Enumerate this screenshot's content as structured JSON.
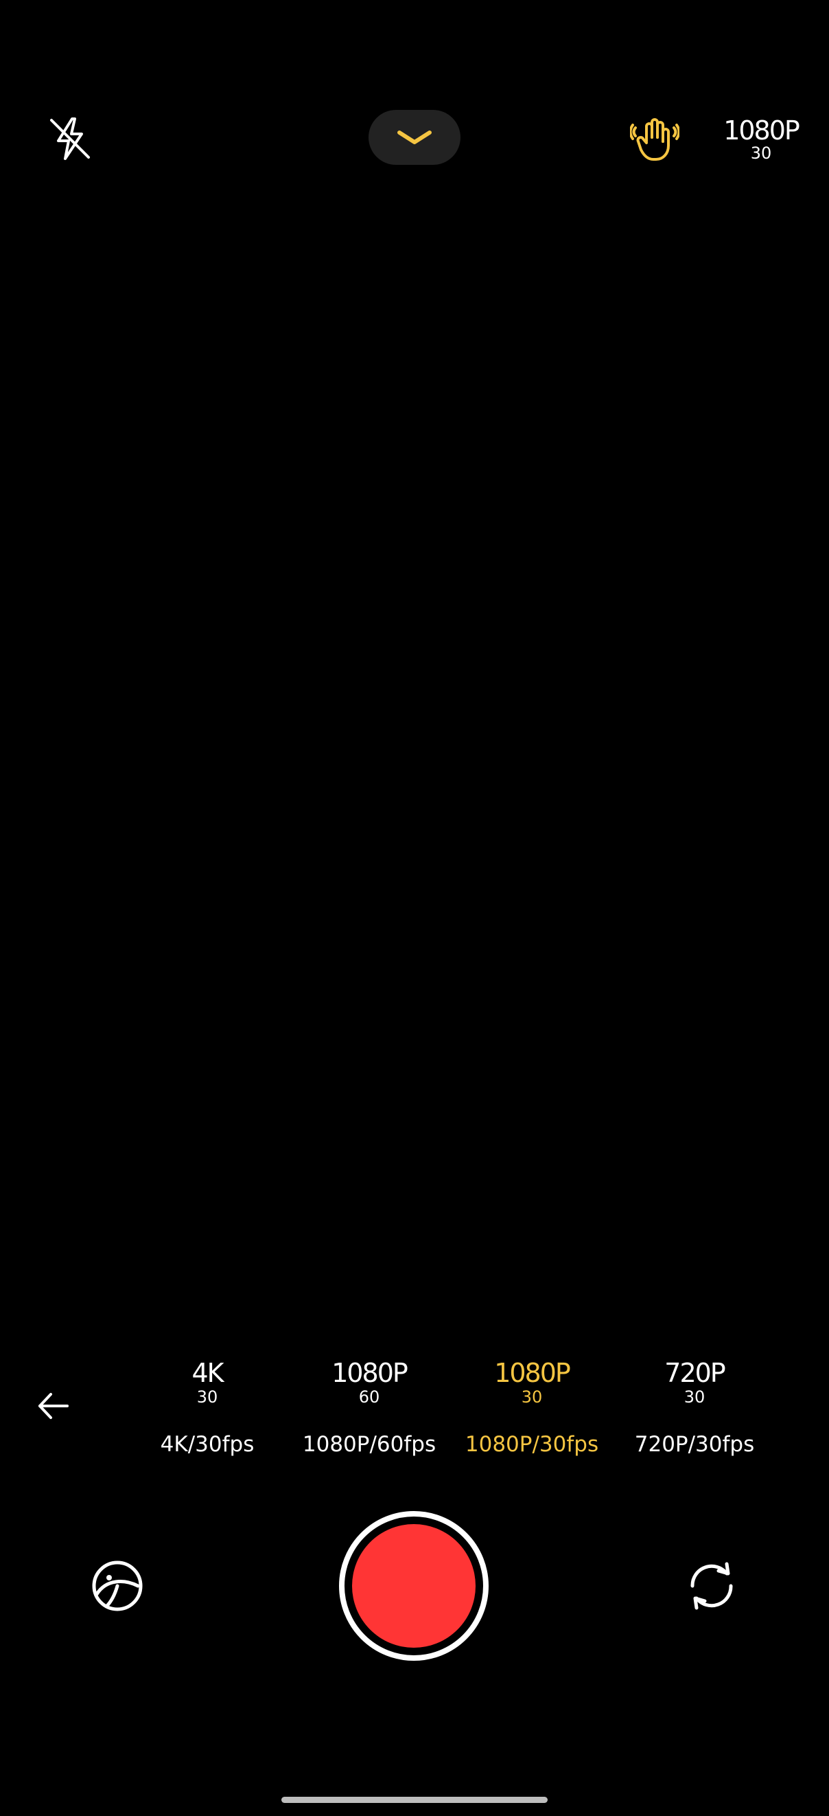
{
  "top_bar": {
    "flash_icon": "flash-off-icon",
    "collapse_icon": "chevron-down-icon",
    "stabilize_icon": "hand-stabilization-icon",
    "resolution_indicator": {
      "primary": "1080P",
      "secondary": "30"
    }
  },
  "resolution_selector": {
    "back_icon": "arrow-left-icon",
    "options": [
      {
        "primary": "4K",
        "secondary": "30",
        "label": "4K/30fps",
        "selected": false
      },
      {
        "primary": "1080P",
        "secondary": "60",
        "label": "1080P/60fps",
        "selected": false
      },
      {
        "primary": "1080P",
        "secondary": "30",
        "label": "1080P/30fps",
        "selected": true
      },
      {
        "primary": "720P",
        "secondary": "30",
        "label": "720P/30fps",
        "selected": false
      }
    ]
  },
  "bottom_bar": {
    "gallery_icon": "gallery-icon",
    "shutter": "record-button",
    "switch_icon": "switch-camera-icon"
  },
  "colors": {
    "background": "#000000",
    "accent": "#f5c542",
    "record": "#ff3535",
    "pill": "#222222"
  }
}
